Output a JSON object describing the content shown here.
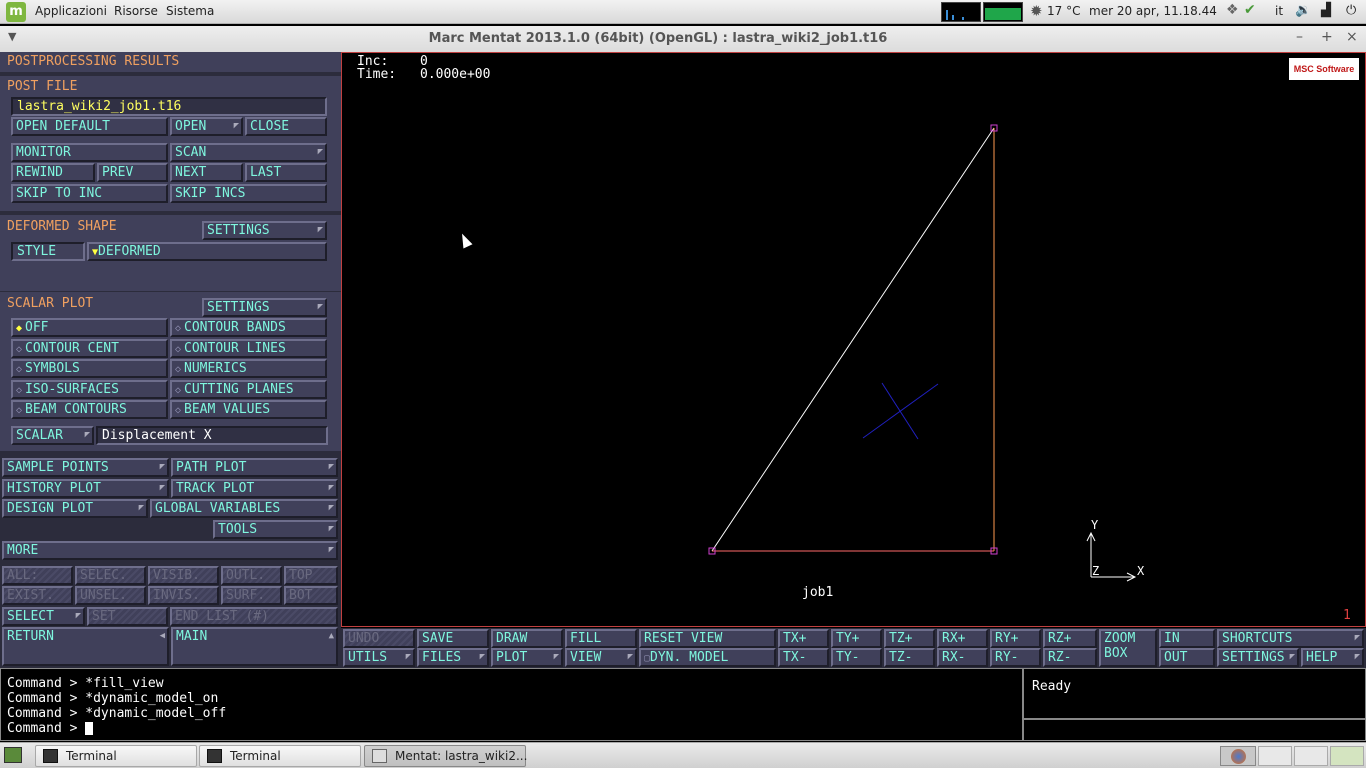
{
  "topbar": {
    "apps": "Applicazioni",
    "places": "Risorse",
    "system": "Sistema",
    "weather": "17 °C",
    "datetime": "mer 20 apr, 11.18.44",
    "lang": "it"
  },
  "window": {
    "title": "Marc Mentat 2013.1.0 (64bit) (OpenGL) : lastra_wiki2_job1.t16"
  },
  "left": {
    "title": "POSTPROCESSING RESULTS",
    "post_file": {
      "header": "POST FILE",
      "filename": "lastra_wiki2_job1.t16",
      "open_default": "OPEN DEFAULT",
      "open": "OPEN",
      "close": "CLOSE",
      "monitor": "MONITOR",
      "scan": "SCAN",
      "rewind": "REWIND",
      "prev": "PREV",
      "next": "NEXT",
      "last": "LAST",
      "skip_to_inc": "SKIP TO INC",
      "skip_incs": "SKIP INCS"
    },
    "deformed": {
      "header": "DEFORMED SHAPE",
      "settings": "SETTINGS",
      "style_label": "STYLE",
      "style_value": "DEFORMED"
    },
    "scalar": {
      "header": "SCALAR PLOT",
      "settings": "SETTINGS",
      "options": [
        "OFF",
        "CONTOUR BANDS",
        "CONTOUR CENT",
        "CONTOUR LINES",
        "SYMBOLS",
        "NUMERICS",
        "ISO-SURFACES",
        "CUTTING PLANES",
        "BEAM CONTOURS",
        "BEAM VALUES"
      ],
      "selected": "OFF",
      "scalar_label": "SCALAR",
      "scalar_value": "Displacement X"
    },
    "plots": {
      "sample_points": "SAMPLE POINTS",
      "path_plot": "PATH PLOT",
      "history_plot": "HISTORY PLOT",
      "track_plot": "TRACK PLOT",
      "design_plot": "DESIGN PLOT",
      "global_variables": "GLOBAL VARIABLES",
      "tools": "TOOLS",
      "more": "MORE"
    },
    "select": {
      "row1": [
        "ALL:",
        "SELEC.",
        "VISIB.",
        "OUTL.",
        "TOP"
      ],
      "row2": [
        "EXIST.",
        "UNSEL.",
        "INVIS.",
        "SURF.",
        "BOT"
      ],
      "select": "SELECT",
      "set": "SET",
      "end_list": "END LIST (#)",
      "return": "RETURN",
      "main": "MAIN"
    }
  },
  "viewport": {
    "inc_label": "Inc:",
    "inc_value": "0",
    "time_label": "Time:",
    "time_value": "0.000e+00",
    "logo": "MSC Software",
    "job_label": "job1",
    "axis_x": "X",
    "axis_y": "Y",
    "axis_z": "Z",
    "window_number": "1"
  },
  "toolbar": {
    "row1": [
      "UNDO",
      "SAVE",
      "DRAW",
      "FILL",
      "RESET VIEW",
      "TX+",
      "TY+",
      "TZ+",
      "RX+",
      "RY+",
      "RZ+",
      "ZOOM BOX",
      "IN",
      "SHORTCUTS"
    ],
    "row2": [
      "UTILS",
      "FILES",
      "PLOT",
      "VIEW",
      "DYN. MODEL",
      "TX-",
      "TY-",
      "TZ-",
      "RX-",
      "RY-",
      "RZ-",
      "OUT",
      "SETTINGS",
      "HELP"
    ]
  },
  "command": {
    "prompt": "Command >",
    "history": [
      "*fill_view",
      " *dynamic_model_on",
      " *dynamic_model_off"
    ],
    "current": ""
  },
  "status": {
    "text": "Ready"
  },
  "taskbar": {
    "tasks": [
      "Terminal",
      "Terminal",
      "Mentat: lastra_wiki2..."
    ]
  },
  "colors": {
    "panel_text": "#7ff7df",
    "header_text": "#f0a060",
    "panel_bg": "#40405a",
    "viewport_border": "#c04040"
  }
}
